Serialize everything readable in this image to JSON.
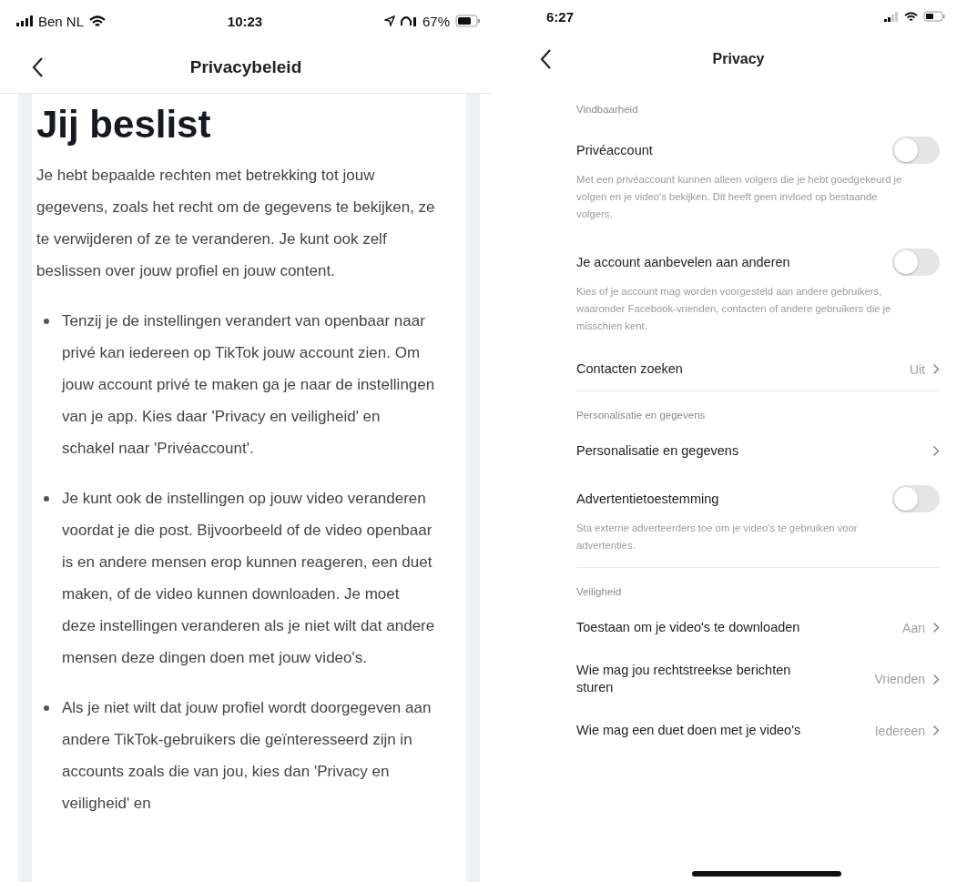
{
  "left": {
    "status_bar": {
      "carrier": "Ben NL",
      "time": "10:23",
      "battery": "67%"
    },
    "nav": {
      "title": "Privacybeleid"
    },
    "heading": "Jij beslist",
    "intro": "Je hebt bepaalde rechten met betrekking tot jouw gegevens, zoals het recht om de gegevens te bekijken, ze te verwijderen of ze te veranderen. Je kunt ook zelf beslissen over jouw profiel en jouw content.",
    "bullets": [
      "Tenzij je de instellingen verandert van openbaar naar privé kan iedereen op TikTok jouw account zien. Om jouw account privé te maken ga je naar de instellingen van je app. Kies daar 'Privacy en veiligheid' en schakel naar 'Privéaccount'.",
      "Je kunt ook de instellingen op jouw video veranderen voordat je die post. Bijvoorbeeld of de video openbaar is en andere mensen erop kunnen reageren, een duet maken, of de video kunnen downloaden. Je moet deze instellingen veranderen als je niet wilt dat andere mensen deze dingen doen met jouw video's.",
      "Als je niet wilt dat jouw profiel wordt doorgegeven aan andere TikTok-gebruikers die geïnteresseerd zijn in accounts zoals die van jou, kies dan 'Privacy en veiligheid' en"
    ]
  },
  "right": {
    "status_bar": {
      "time": "6:27"
    },
    "nav": {
      "title": "Privacy"
    },
    "sections": [
      {
        "header": "Vindbaarheid",
        "items": [
          {
            "kind": "toggle",
            "label": "Privéaccount",
            "description": "Met een privéaccount kunnen alleen volgers die je hebt goedgekeurd je volgen en je video's bekijken. Dit heeft geen invloed op bestaande volgers.",
            "on": false
          },
          {
            "kind": "toggle",
            "label": "Je account aanbevelen aan anderen",
            "description": "Kies of je account mag worden voorgesteld aan andere gebruikers, waaronder Facebook-vrienden, contacten of andere gebruikers die je misschien kent.",
            "on": false
          },
          {
            "kind": "link",
            "label": "Contacten zoeken",
            "value": "Uit"
          }
        ]
      },
      {
        "header": "Personalisatie en gegevens",
        "items": [
          {
            "kind": "link",
            "label": "Personalisatie en gegevens"
          },
          {
            "kind": "toggle",
            "label": "Advertentietoestemming",
            "description": "Sta externe adverteerders toe om je video's te gebruiken voor advertenties.",
            "on": false
          }
        ]
      },
      {
        "header": "Veiligheid",
        "items": [
          {
            "kind": "link",
            "label": "Toestaan om je video's te downloaden",
            "value": "Aan"
          },
          {
            "kind": "link",
            "label": "Wie mag jou rechtstreekse berichten sturen",
            "value": "Vrienden"
          },
          {
            "kind": "link",
            "label": "Wie mag een duet doen met je video's",
            "value": "Iedereen"
          }
        ]
      }
    ]
  }
}
